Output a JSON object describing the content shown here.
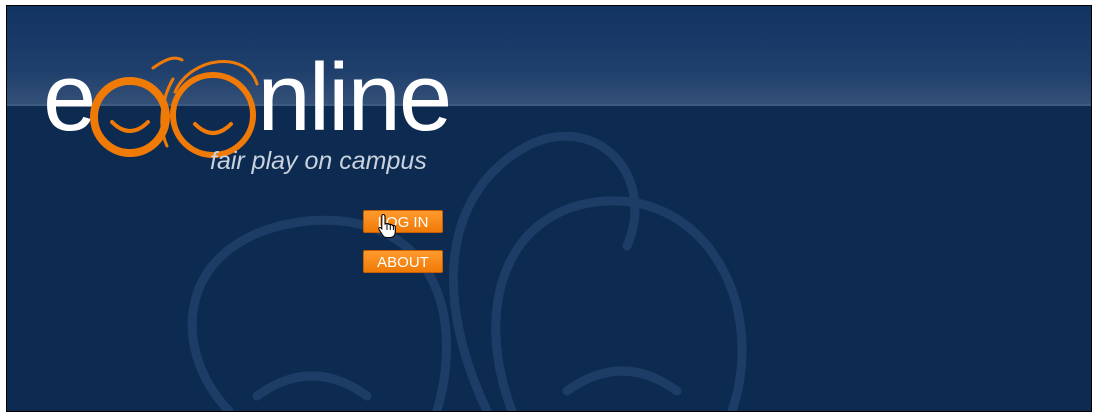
{
  "logo": {
    "wordmark_prefix": "e",
    "wordmark_suffix": "nline",
    "tagline": "fair play on campus",
    "accent_color": "#f07a06"
  },
  "nav": {
    "login_label": "LOG IN",
    "about_label": "ABOUT"
  },
  "colors": {
    "background": "#0d2a50",
    "button": "#f58412",
    "text": "#ffffff"
  },
  "icons": {
    "cursor": "hand-pointer-icon"
  }
}
